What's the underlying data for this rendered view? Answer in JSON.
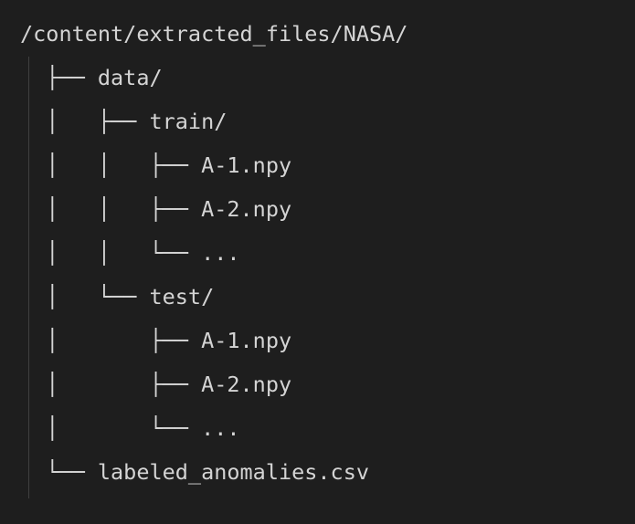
{
  "editor": {
    "lines": [
      "/content/extracted_files/NASA/",
      "  ├── data/",
      "  │   ├── train/",
      "  │   │   ├── A-1.npy",
      "  │   │   ├── A-2.npy",
      "  │   │   └── ...",
      "  │   └── test/",
      "  │       ├── A-1.npy",
      "  │       ├── A-2.npy",
      "  │       └── ...",
      "  └── labeled_anomalies.csv"
    ]
  }
}
